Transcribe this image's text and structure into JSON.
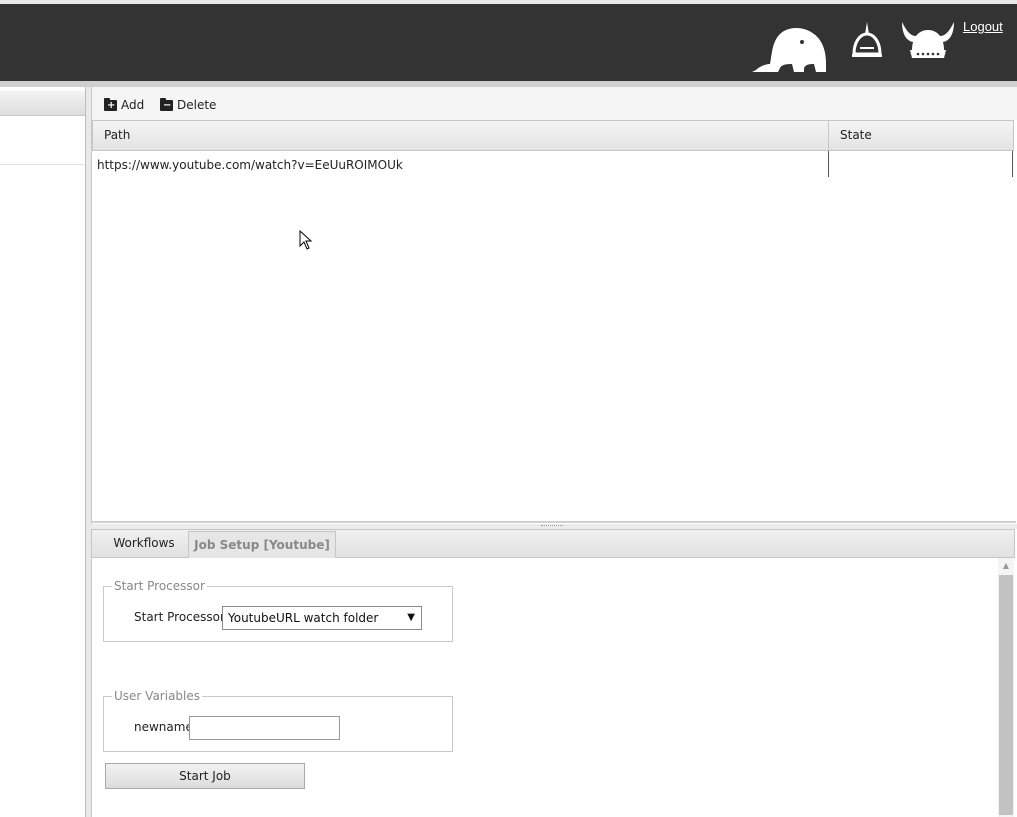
{
  "header": {
    "logout_label": "Logout",
    "icons": [
      "elephant-icon",
      "spiked-helmet-icon",
      "viking-helmet-icon"
    ]
  },
  "toolbar": {
    "add_label": "Add",
    "delete_label": "Delete"
  },
  "grid": {
    "columns": [
      "Path",
      "State"
    ],
    "rows": [
      {
        "path": "https://www.youtube.com/watch?v=EeUuROIMOUk",
        "state": ""
      }
    ]
  },
  "tabs": [
    {
      "label": "Workflows"
    },
    {
      "label": "Job Setup [Youtube]"
    }
  ],
  "job_setup": {
    "start_processor_legend": "Start Processor",
    "start_processor_label": "Start Processor:",
    "start_processor_value": "YoutubeURL watch folder",
    "user_variables_legend": "User Variables",
    "newname_label": "newname",
    "newname_value": "",
    "start_job_label": "Start Job"
  },
  "colors": {
    "header_bg": "#333333",
    "header_text": "#ffffff"
  }
}
